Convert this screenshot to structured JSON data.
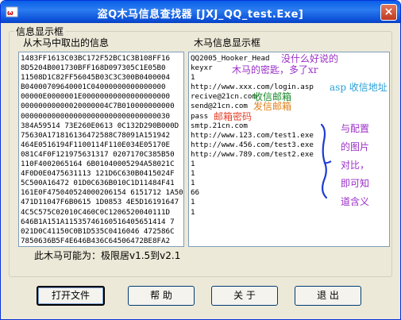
{
  "window": {
    "title": "盗Q木马信息查找器 [JXJ_QQ_test.Exe]",
    "close_glyph": "×"
  },
  "group": {
    "title": "信息显示框"
  },
  "left_panel": {
    "label": "从木马中取出的信息",
    "lines": [
      "1483FF1613C03BC172F52BC1C3B108FF16",
      "8D5204B001730BFF168D097305C1E05B0",
      "11508D1C82FF56045B03C3C300B0400004",
      "B04000709640001C04000000000000000",
      "00000E0000001E00000000000000000000",
      "00000000000020000004C7B010000000000",
      "0000000000000000000000000000000030",
      "384A59514 73E260E0613 0C132D290B000D",
      "75630A171816136472588C78091A151942",
      "464E0516194F1100114F110E034E05170E",
      "081C4F0F121975631317 0207170C385B50",
      "110F4002065164 6B01040005294A58021C",
      "4F0D0E0475631113 121D6C630B0415024F",
      "5C500A16472 01D0C636B010C1D11484F41",
      "161E0F475040524000206154 6151712 1A50",
      "471D11047F6B0615 1D0853 4E5D16191647",
      "4C5C575C02010C460C0C1206520040111D",
      "646B1A151A11535746160516405651414 7",
      "021D0C41150C0B1D535C0416046 472586C",
      "7850636B5F4E646B436C64506472BE8FA2"
    ]
  },
  "right_panel": {
    "label": "木马信息显示框",
    "lines": [
      "QQ2005_Hooker_Head",
      "keyxr",
      "1",
      "http://www.xxx.com/login.asp",
      "recive@21cn.com",
      "send@21cn.com",
      "pass",
      "smtp.21cn.com",
      "http://www.123.com/test1.exe",
      "http://www.456.com/test3.exe",
      "http://www.789.com/test2.exe",
      "1",
      "1",
      "1",
      "66",
      "1",
      "1"
    ]
  },
  "annotations": {
    "note1": "没什么好说的",
    "note2": "木马的密匙，多了xr",
    "note3": "asp 收信地址",
    "note4": "收信邮箱",
    "note5": "发信邮箱",
    "note6": "邮箱密码",
    "side_lines": [
      "与配置",
      "的图片",
      "对比，",
      "即可知",
      "道含义"
    ]
  },
  "status_text": "此木马可能为：极限居v1.5到v2.1",
  "buttons": {
    "open": "打开文件",
    "help": "帮  助",
    "about": "关  于",
    "exit": "退  出"
  },
  "colors": {
    "red_note": "#e8402a",
    "purple_note": "#9b2fc8",
    "cyan_note": "#2a9fd6",
    "green_note": "#1a8a2a",
    "orange_note": "#e0801a",
    "blue_brace": "#1c3bd4"
  }
}
